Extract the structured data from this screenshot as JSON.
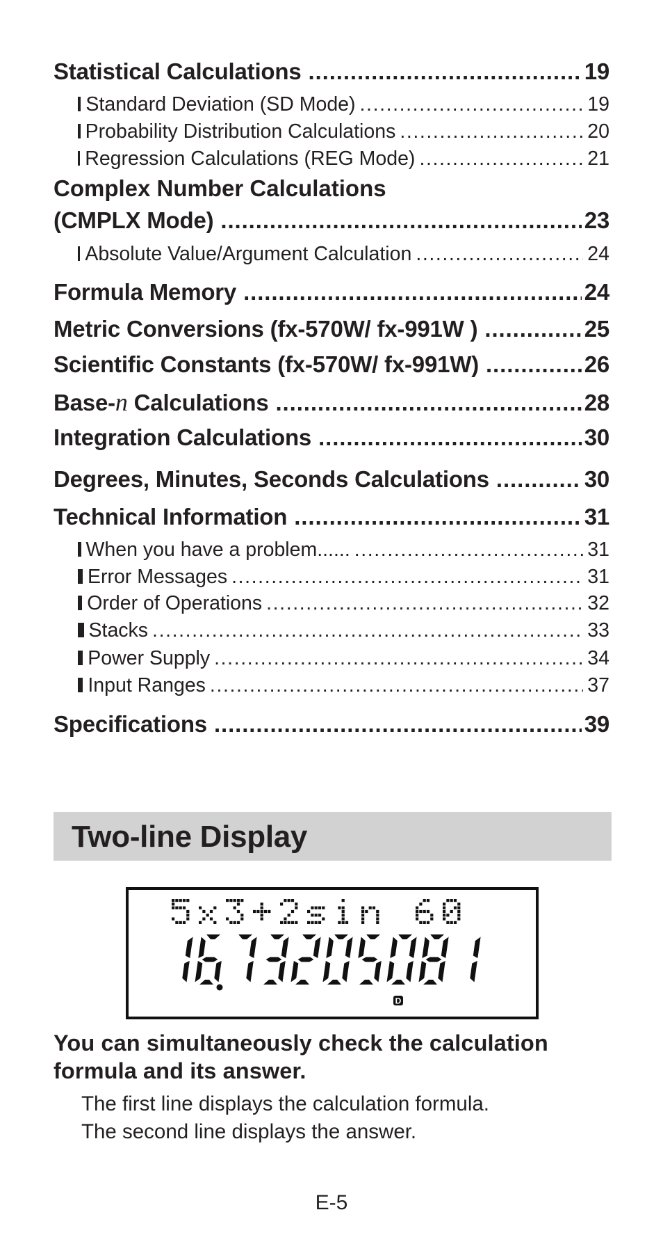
{
  "toc": {
    "statistical": {
      "label": "Statistical Calculations",
      "page": "19"
    },
    "sd": {
      "label": "Standard Deviation (SD Mode)",
      "page": "19"
    },
    "probability": {
      "label": "Probability Distribution Calculations",
      "page": "20"
    },
    "regression": {
      "label": "Regression Calculations (REG Mode)",
      "page": "21"
    },
    "complex_line1": "Complex Number Calculations",
    "complex": {
      "label": "(CMPLX Mode)",
      "page": "23"
    },
    "absolute": {
      "label": "Absolute Value/Argument Calculation",
      "page": "24"
    },
    "formula": {
      "label": "Formula Memory",
      "page": "24"
    },
    "metric": {
      "label": "Metric Conversions (fx-570W/ fx-991W )",
      "page": "25"
    },
    "scientific": {
      "label": "Scientific Constants (fx-570W/ fx-991W)",
      "page": "26"
    },
    "basen": {
      "label_prefix": "Base-",
      "label_italic": "n",
      "label_suffix": " Calculations",
      "page": "28"
    },
    "integration": {
      "label": "Integration Calculations",
      "page": "30"
    },
    "degrees": {
      "label": "Degrees, Minutes, Seconds Calculations",
      "page": "30"
    },
    "technical": {
      "label": "Technical Information",
      "page": "31"
    },
    "problem": {
      "label": "When you have a problem......",
      "page": "31"
    },
    "errors": {
      "label": "Error Messages",
      "page": "31"
    },
    "order": {
      "label": "Order of Operations",
      "page": "32"
    },
    "stacks": {
      "label": "Stacks",
      "page": "33"
    },
    "power": {
      "label": "Power Supply",
      "page": "34"
    },
    "input": {
      "label": "Input Ranges",
      "page": "37"
    },
    "specifications": {
      "label": "Specifications",
      "page": "39"
    }
  },
  "section": {
    "title": "Two-line Display"
  },
  "display": {
    "formula_line": "5x3+2sin 60",
    "answer_line": "16.73205081",
    "indicator": "D"
  },
  "description": {
    "lead": "You can simultaneously check the calculation formula and its answer.",
    "line1": "The first line displays the calculation formula.",
    "line2": "The second line displays the answer."
  },
  "footer": {
    "page_number": "E-5"
  }
}
